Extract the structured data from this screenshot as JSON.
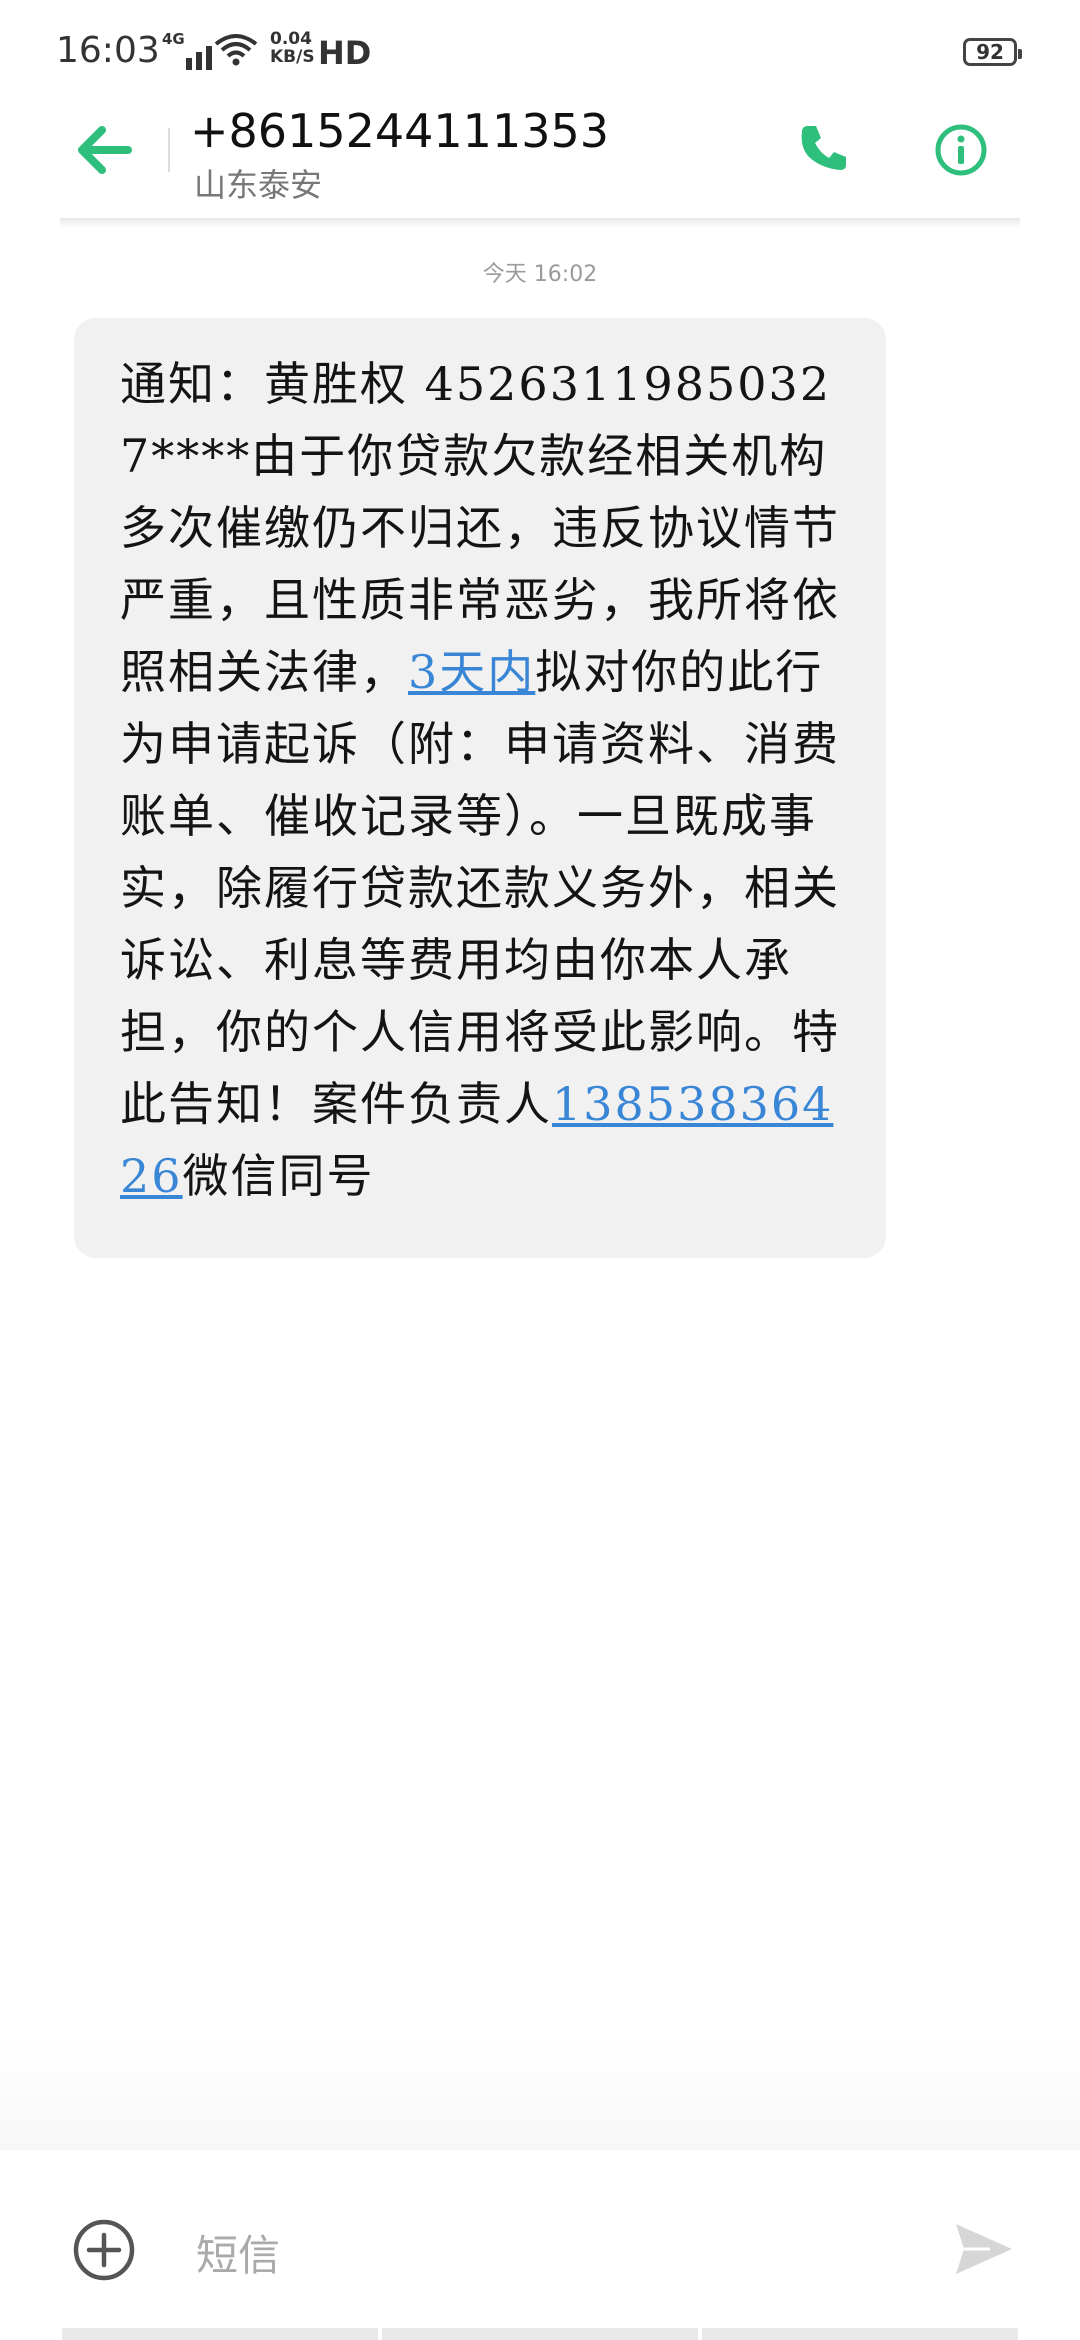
{
  "status_bar": {
    "time": "16:03",
    "network": "4G",
    "speed_value": "0.04",
    "speed_unit": "KB/S",
    "hd": "HD",
    "battery": "92"
  },
  "header": {
    "contact_number": "+8615244111353",
    "contact_location": "山东泰安"
  },
  "conversation": {
    "timestamp": "今天 16:02",
    "message": {
      "text_before_link": "通知：黄胜权 45263119850327****由于你贷款欠款经相关机构多次催缴仍不归还，违反协议情节严重，且性质非常恶劣，我所将依照相关法律，",
      "link1": "3天内",
      "text_middle": "拟对你的此行为申请起诉（附：申请资料、消费账单、催收记录等）。一旦既成事实，除履行贷款还款义务外，相关诉讼、利息等费用均由你本人承担，你的个人信用将受此影响。特此告知！案件负责人",
      "link2": "13853836426",
      "text_after_link": "微信同号"
    }
  },
  "composer": {
    "placeholder": "短信"
  },
  "colors": {
    "accent_green": "#2fbf7c",
    "link_blue": "#3a86d6",
    "bubble_bg": "#f1f1f1"
  }
}
